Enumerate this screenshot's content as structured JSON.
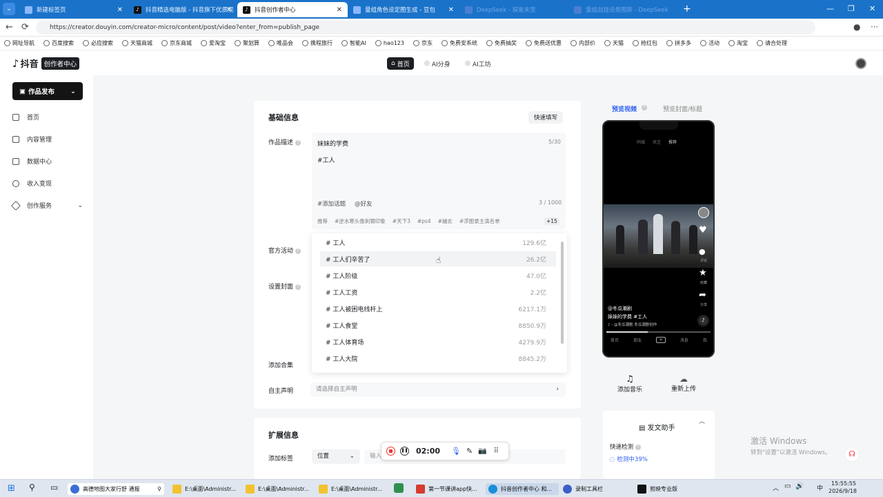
{
  "browser": {
    "tabs": [
      {
        "title": "新建标签页",
        "active": false
      },
      {
        "title": "抖音精选电脑版 - 抖音旗下优质视",
        "active": false
      },
      {
        "title": "抖音创作者中心",
        "active": true
      },
      {
        "title": "量组角色设定图生成 - 豆包",
        "active": false
      },
      {
        "title": "DeepSeek - 探索未至",
        "active": false
      },
      {
        "title": "量组战挂设是图新 - DeepSeek",
        "active": false
      }
    ],
    "url": "https://creator.douyin.com/creator-micro/content/post/video?enter_from=publish_page",
    "bookmarks": [
      "网址导航",
      "百度搜索",
      "必应搜索",
      "天猫商城",
      "京东商城",
      "爱淘宝",
      "聚划算",
      "唯品会",
      "携程旅行",
      "智能AI",
      "hao123",
      "京东",
      "免费安系统",
      "免费抽奖",
      "免费送优惠",
      "内部价",
      "天猫",
      "抢红包",
      "拼多多",
      "活动",
      "淘宝",
      "请合处理"
    ]
  },
  "app": {
    "logo": "抖音",
    "logo_badge": "创作者中心",
    "top_nav": [
      "首页",
      "AI分身",
      "AI工坊"
    ],
    "sidebar": {
      "publish": "作品发布",
      "items": [
        "首页",
        "内容管理",
        "数据中心",
        "收入变现",
        "创作服务"
      ]
    }
  },
  "form": {
    "section_basic": "基础信息",
    "quick_fill": "快速填写",
    "desc_label": "作品描述",
    "title_value": "妹妹的学费",
    "title_count": "5/30",
    "body_value": "#工人",
    "add_topic": "#添加话题",
    "mention": "@好友",
    "body_count": "3 / 1000",
    "rec_label": "推荐",
    "rec_chips": [
      "#逆水寒头像刺猬印象",
      "#天下3",
      "#ps4",
      "#捕玄",
      "#浮图录主演名单"
    ],
    "rec_more": "+15",
    "official_label": "官方活动",
    "cover_label": "设置封面",
    "collection_label": "添加合集",
    "declare_label": "自主声明",
    "declare_placeholder": "请选择自主声明",
    "section_ext": "扩展信息",
    "tag_label": "添加标签",
    "location_select": "位置",
    "tag_input_placeholder": "输入"
  },
  "dropdown": [
    {
      "tag": "工人",
      "count": "129.6亿"
    },
    {
      "tag": "工人们辛苦了",
      "count": "26.2亿"
    },
    {
      "tag": "工人阶级",
      "count": "47.0亿"
    },
    {
      "tag": "工人工资",
      "count": "2.2亿"
    },
    {
      "tag": "工人被困电线杆上",
      "count": "6217.1万"
    },
    {
      "tag": "工人食堂",
      "count": "8850.9万"
    },
    {
      "tag": "工人体育场",
      "count": "4279.9万"
    },
    {
      "tag": "工人大院",
      "count": "8845.2万"
    }
  ],
  "preview": {
    "tab_video": "预览视频",
    "tab_cover": "预览封面/标题",
    "phone_top": [
      "同城",
      "关注",
      "推荐"
    ],
    "author": "@冬瓜潮剧",
    "caption": "妹妹的学费 #工人",
    "music": "♪ - @冬瓜潮剧 冬瓜潮剧创作",
    "side_labels": [
      "评论",
      "收藏",
      "分享"
    ],
    "bottom_nav": [
      "首页",
      "朋友",
      "+",
      "消息",
      "我"
    ],
    "add_music": "添加音乐",
    "reupload": "重新上传",
    "assistant_title": "发文助手",
    "quick_check": "快速检测",
    "checking": "检测中39%"
  },
  "recorder": {
    "time": "02:00"
  },
  "watermark": {
    "line1": "激活 Windows",
    "line2": "转到\"设置\"以激活 Windows。"
  },
  "taskbar": {
    "items": [
      "高德地图大家行舒 通报",
      "E:\\桌面\\Administr...",
      "E:\\桌面\\Administr...",
      "E:\\桌面\\Administr...",
      "第一节课讲app快...",
      "抖音创作者中心 和...",
      "录制工具栏",
      "剪映专业版"
    ],
    "ime": "中",
    "time": "15:55:55",
    "date": "2026/9/18"
  }
}
